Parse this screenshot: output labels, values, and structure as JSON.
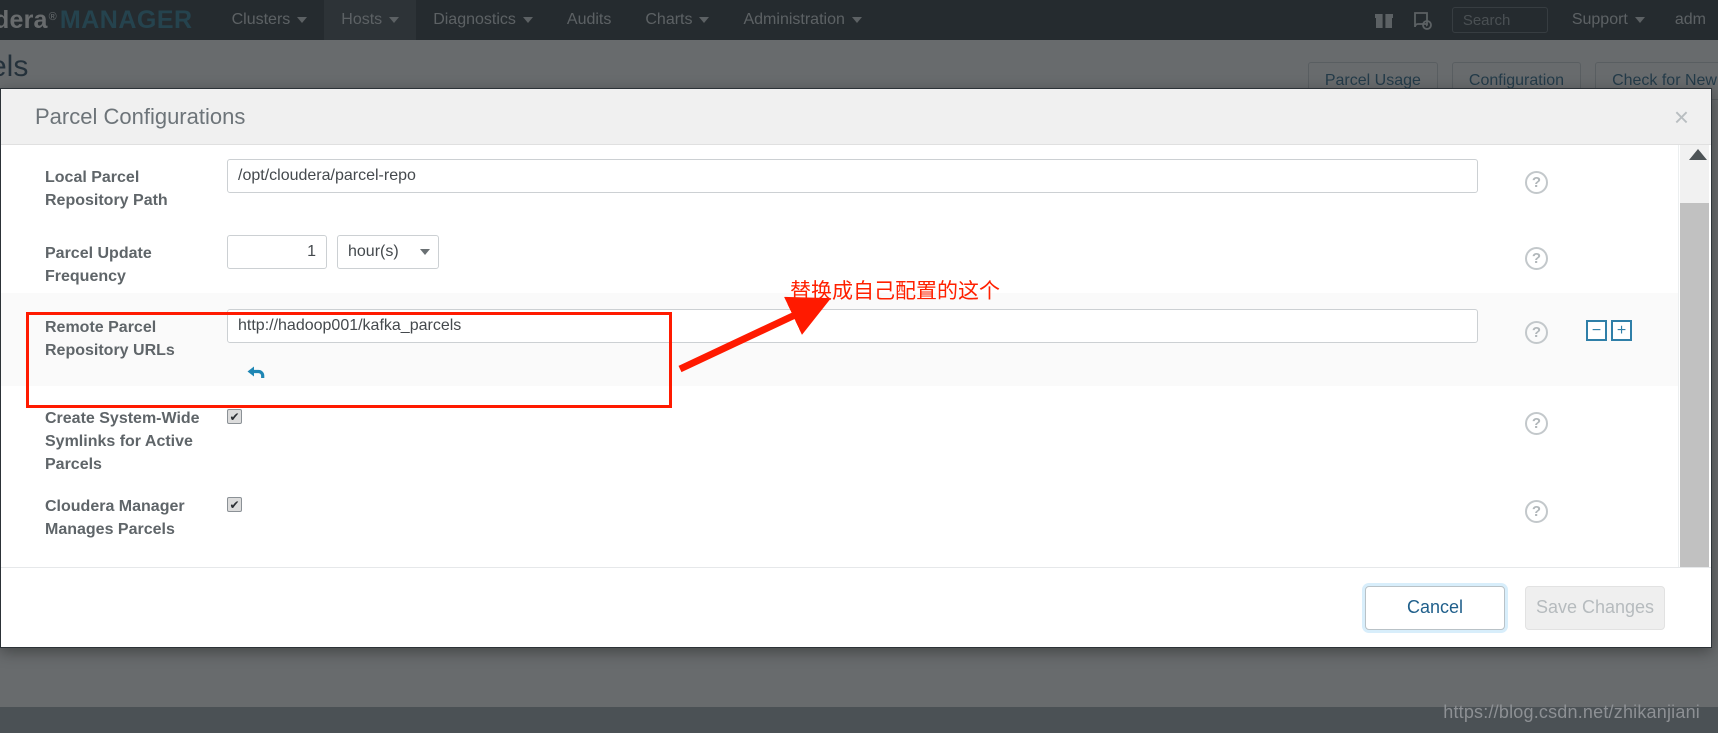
{
  "topnav": {
    "brand_main": "dera",
    "brand_reg": "®",
    "brand_sub": "MANAGER",
    "items": [
      {
        "label": "Clusters",
        "has_caret": true,
        "active": false
      },
      {
        "label": "Hosts",
        "has_caret": true,
        "active": true
      },
      {
        "label": "Diagnostics",
        "has_caret": true,
        "active": false
      },
      {
        "label": "Audits",
        "has_caret": false,
        "active": false
      },
      {
        "label": "Charts",
        "has_caret": true,
        "active": false
      },
      {
        "label": "Administration",
        "has_caret": true,
        "active": false
      }
    ],
    "gift_icon": "gift-icon",
    "scroll_icon": "script-icon",
    "search_placeholder": "Search",
    "support_label": "Support",
    "user_label": "adm"
  },
  "page": {
    "title": "els",
    "buttons": [
      "Parcel Usage",
      "Configuration",
      "Check for New Pa"
    ]
  },
  "modal": {
    "title": "Parcel Configurations",
    "close_label": "×",
    "rows": [
      {
        "name": "local-parcel-repository-path",
        "label": "Local Parcel Repository Path",
        "type": "text",
        "value": "/opt/cloudera/parcel-repo"
      },
      {
        "name": "parcel-update-frequency",
        "label": "Parcel Update Frequency",
        "type": "number-unit",
        "value": "1",
        "unit": "hour(s)"
      },
      {
        "name": "remote-parcel-repository-urls",
        "label": "Remote Parcel Repository URLs",
        "type": "url-list",
        "value": "http://hadoop001/kafka_parcels",
        "minus_label": "−",
        "plus_label": "+",
        "undo_label": "undo-arrow-icon"
      },
      {
        "name": "create-system-wide-symlinks",
        "label": "Create System-Wide Symlinks for Active Parcels",
        "type": "checkbox",
        "checked": true
      },
      {
        "name": "cloudera-manager-manages-parcels",
        "label": "Cloudera Manager Manages Parcels",
        "type": "checkbox",
        "checked": true
      }
    ],
    "help_label": "?",
    "footer": {
      "cancel_label": "Cancel",
      "save_label": "Save Changes"
    }
  },
  "annotation": {
    "text": "替换成自己配置的这个",
    "color": "#ff2000",
    "arrow": "red-arrow-icon",
    "box": "red-highlight-box"
  },
  "watermark": {
    "text": "https://blog.csdn.net/zhikanjiani"
  },
  "checkbox": {
    "checked_glyph": "✔"
  }
}
